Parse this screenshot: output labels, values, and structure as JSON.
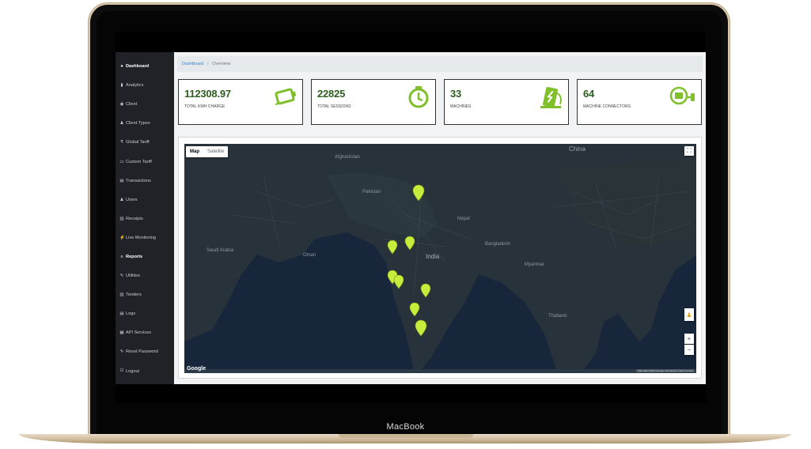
{
  "device": {
    "brand_label": "MacBook"
  },
  "sidebar": {
    "items": [
      {
        "icon": "dashboard-icon",
        "glyph": "●",
        "label": "Dashboard",
        "active": true
      },
      {
        "icon": "analytics-icon",
        "glyph": "▮",
        "label": "Analytics"
      },
      {
        "icon": "eye-icon",
        "glyph": "◉",
        "label": "Client"
      },
      {
        "icon": "user-icon",
        "glyph": "♟",
        "label": "Client Types"
      },
      {
        "icon": "tariff-icon",
        "glyph": "₹",
        "label": "Global Tariff"
      },
      {
        "icon": "card-icon",
        "glyph": "▭",
        "label": "Custom Tariff"
      },
      {
        "icon": "transactions-icon",
        "glyph": "▤",
        "label": "Transactions"
      },
      {
        "icon": "user-icon",
        "glyph": "♟",
        "label": "Users"
      },
      {
        "icon": "receipt-icon",
        "glyph": "▥",
        "label": "Receipts"
      },
      {
        "icon": "monitor-icon",
        "glyph": "⚡",
        "label": "Live Monitoring"
      },
      {
        "icon": "reports-icon",
        "glyph": "≡",
        "label": "Reports",
        "active": true
      },
      {
        "icon": "wrench-icon",
        "glyph": "✎",
        "label": "Utilities"
      },
      {
        "icon": "tenders-icon",
        "glyph": "▥",
        "label": "Tenders"
      },
      {
        "icon": "logs-icon",
        "glyph": "▤",
        "label": "Logs"
      },
      {
        "icon": "api-icon",
        "glyph": "▦",
        "label": "API Services"
      },
      {
        "icon": "key-icon",
        "glyph": "✎",
        "label": "Reset Password"
      },
      {
        "icon": "power-icon",
        "glyph": "⏻",
        "label": "Logout"
      }
    ]
  },
  "breadcrumb": {
    "home": "Dashboard",
    "separator": "/",
    "current": "Overview"
  },
  "cards": [
    {
      "value": "112308.97",
      "label": "TOTAL KWH CHARGE",
      "icon": "battery-icon"
    },
    {
      "value": "22825",
      "label": "TOTAL SESSIONS",
      "icon": "timer-icon"
    },
    {
      "value": "33",
      "label": "MACHINES",
      "icon": "charging-station-icon"
    },
    {
      "value": "64",
      "label": "MACHINE CONNECTORS",
      "icon": "plug-icon"
    }
  ],
  "map": {
    "type_options": [
      "Map",
      "Satellite"
    ],
    "selected_type": "Map",
    "labels": {
      "china": "China",
      "india": "India",
      "pakistan": "Pakistan",
      "afghanistan": "Afghanistan",
      "saudi": "Saudi Arabia",
      "oman": "Oman",
      "bangladesh": "Bangladesh",
      "myanmar": "Myanmar",
      "thailand": "Thailand",
      "nepal": "Nepal"
    },
    "zoom_in": "+",
    "zoom_out": "−",
    "fullscreen": "⛶",
    "google_logo": "Google",
    "attribution": "Map data ©2021 Google, SK telecom | Terms of Use",
    "marker_color": "#c8ec3c"
  },
  "colors": {
    "accent_green": "#2f5d1f",
    "sidebar_bg": "#1f2328",
    "link": "#3a82c4"
  }
}
